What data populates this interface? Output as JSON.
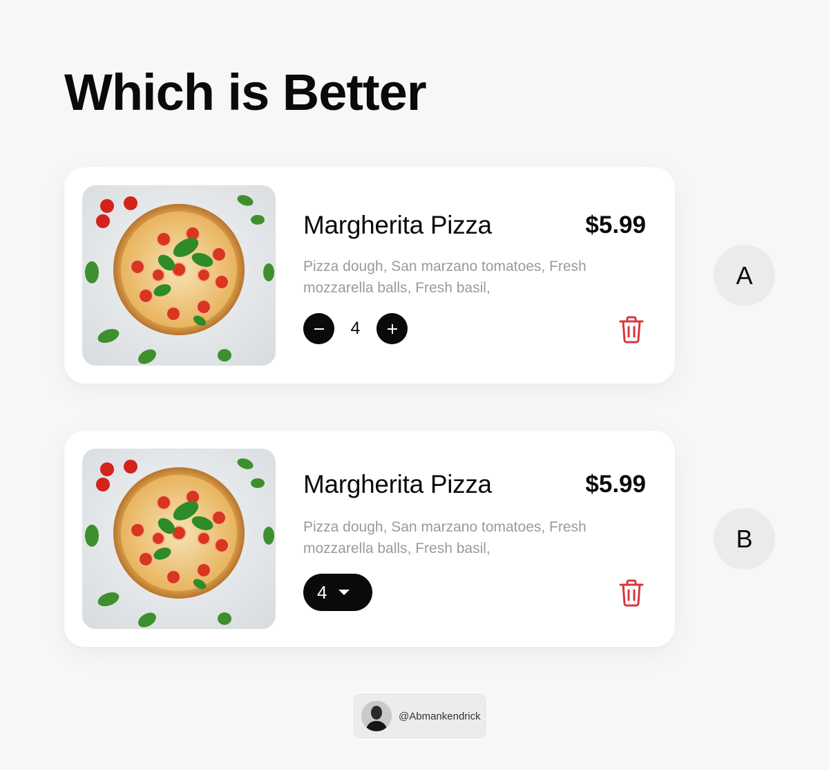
{
  "title": "Which is Better",
  "cards": [
    {
      "variant": "A",
      "name": "Margherita Pizza",
      "price": "$5.99",
      "description": "Pizza dough, San marzano tomatoes, Fresh mozzarella balls, Fresh basil,",
      "quantity": "4",
      "quantity_control": "stepper"
    },
    {
      "variant": "B",
      "name": "Margherita Pizza",
      "price": "$5.99",
      "description": "Pizza dough, San marzano tomatoes, Fresh mozzarella balls, Fresh basil,",
      "quantity": "4",
      "quantity_control": "dropdown"
    }
  ],
  "icons": {
    "minus": "minus-icon",
    "plus": "plus-icon",
    "caret": "chevron-down-icon",
    "trash": "trash-icon"
  },
  "colors": {
    "trash": "#d9353b",
    "control": "#0a0a0a",
    "badge": "#ebebed"
  },
  "credit": {
    "handle": "@Abmankendrick"
  }
}
